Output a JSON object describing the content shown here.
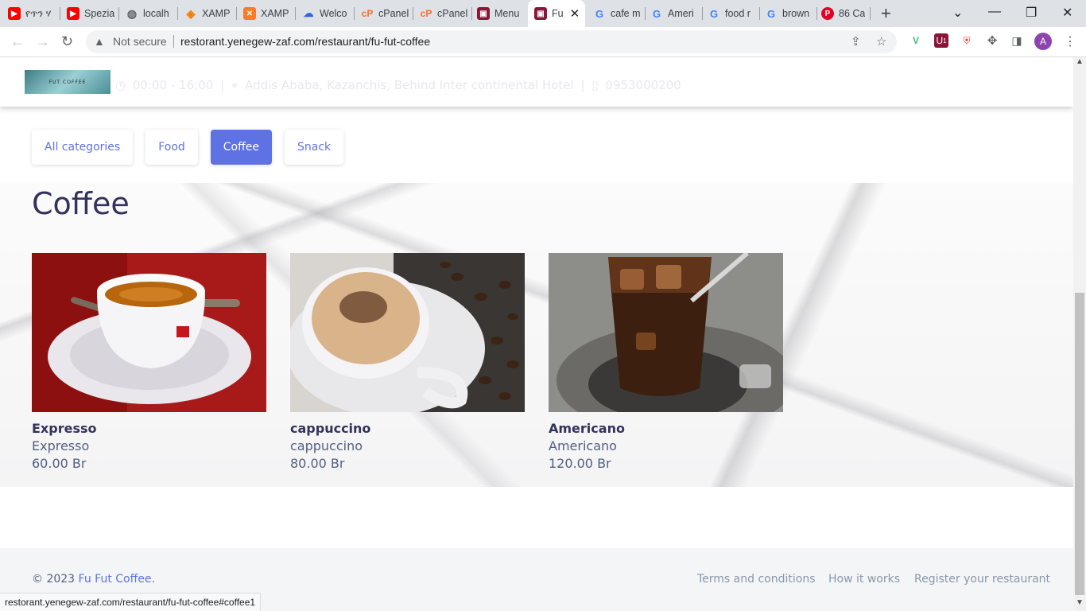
{
  "browser": {
    "tabs": [
      {
        "title": "የጥን ሃ",
        "icon": "youtube-icon"
      },
      {
        "title": "Spezia",
        "icon": "youtube-icon"
      },
      {
        "title": "localh",
        "icon": "globe-icon"
      },
      {
        "title": "XAMP",
        "icon": "xampp-icon"
      },
      {
        "title": "XAMP",
        "icon": "xampp-icon"
      },
      {
        "title": "Welco",
        "icon": "cloud-icon"
      },
      {
        "title": "cPanel",
        "icon": "cpanel-icon"
      },
      {
        "title": "cPanel",
        "icon": "cpanel-icon"
      },
      {
        "title": "Menu",
        "icon": "restaurant-icon"
      },
      {
        "title": "Fu",
        "icon": "restaurant-icon"
      },
      {
        "title": "cafe m",
        "icon": "google-icon"
      },
      {
        "title": "Ameri",
        "icon": "google-icon"
      },
      {
        "title": "food r",
        "icon": "google-icon"
      },
      {
        "title": "brown",
        "icon": "google-icon"
      },
      {
        "title": "86 Ca",
        "icon": "pinterest-icon"
      }
    ],
    "security_label": "Not secure",
    "url": "restorant.yenegew-zaf.com/restaurant/fu-fut-coffee",
    "profile_initial": "A",
    "extension_badge": "1",
    "status_url": "restorant.yenegew-zaf.com/restaurant/fu-fut-coffee#coffee1"
  },
  "header": {
    "logo_text": "FUT COFFEE",
    "hours": "00:00 - 16:00",
    "address": "Addis Ababa, Kazanchis, Behind Inter continental Hotel",
    "phone": "0953000200"
  },
  "categories": [
    {
      "label": "All categories",
      "active": false
    },
    {
      "label": "Food",
      "active": false
    },
    {
      "label": "Coffee",
      "active": true
    },
    {
      "label": "Snack",
      "active": false
    }
  ],
  "section": {
    "title": "Coffee"
  },
  "items": [
    {
      "name": "Expresso",
      "description": "Expresso",
      "price": "60.00 Br"
    },
    {
      "name": "cappuccino",
      "description": "cappuccino",
      "price": "80.00 Br"
    },
    {
      "name": "Americano",
      "description": "Americano",
      "price": "120.00 Br"
    }
  ],
  "footer": {
    "copyright": "© 2023",
    "brand": "Fu Fut Coffee.",
    "links": [
      "Terms and conditions",
      "How it works",
      "Register your restaurant"
    ]
  },
  "colors": {
    "accent": "#5e72e4",
    "heading": "#32325d",
    "text": "#525f7f"
  }
}
